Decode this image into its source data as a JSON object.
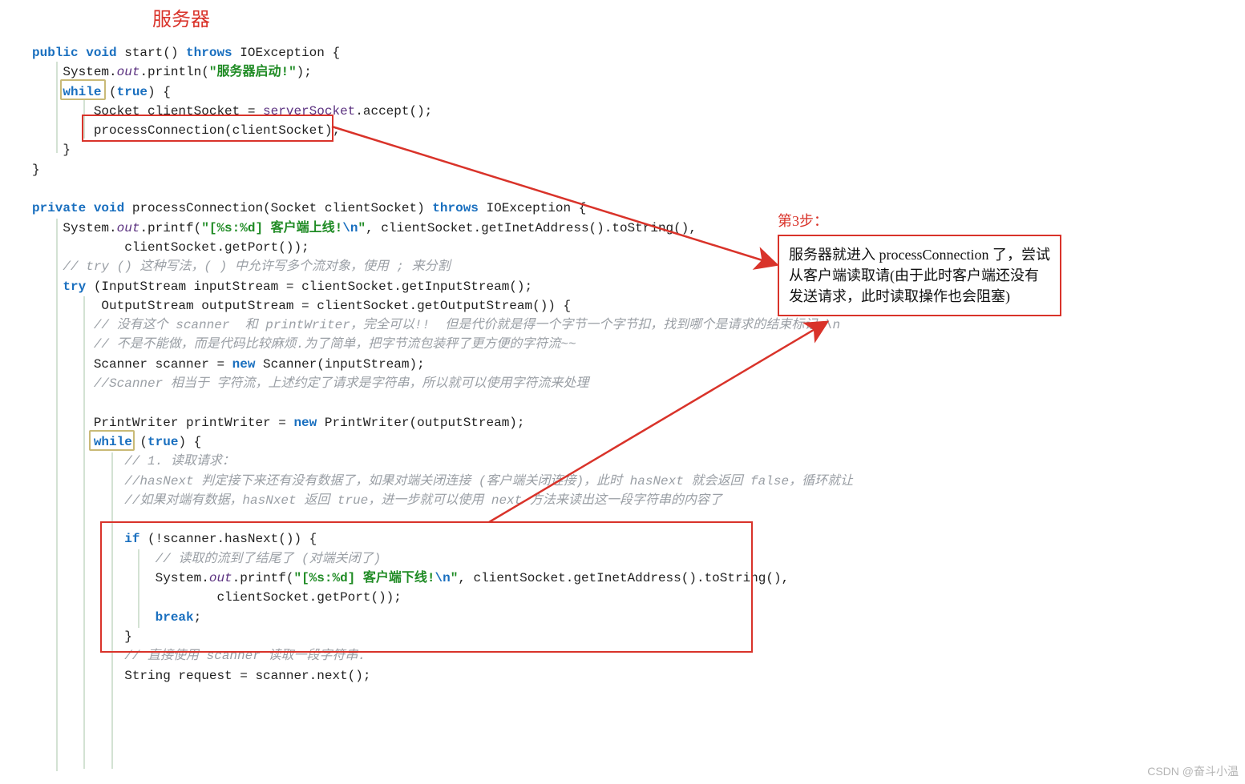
{
  "title": "服务器",
  "step_label": "第3步：",
  "callout": "服务器就进入 processConnection 了，尝试从客户端读取请(由于此时客户端还没有发送请求，此时读取操作也会阻塞)",
  "watermark": "CSDN @奋斗小温",
  "lines": [
    [
      [
        "kw",
        "public"
      ],
      [
        "p",
        " "
      ],
      [
        "kw",
        "void"
      ],
      [
        "p",
        " "
      ],
      [
        "p",
        "start() "
      ],
      [
        "kw",
        "throws"
      ],
      [
        "p",
        " IOException {"
      ]
    ],
    [
      [
        "p",
        "    System."
      ],
      [
        "id ital",
        "out"
      ],
      [
        "p",
        ".println("
      ],
      [
        "str",
        "\"服务器启动!\""
      ],
      [
        "p",
        ");"
      ]
    ],
    [
      [
        "p",
        "    "
      ],
      [
        "kw",
        "while"
      ],
      [
        "p",
        " ("
      ],
      [
        "kw",
        "true"
      ],
      [
        "p",
        ") {"
      ]
    ],
    [
      [
        "p",
        "        Socket clientSocket = "
      ],
      [
        "id",
        "serverSocket"
      ],
      [
        "p",
        ".accept();"
      ]
    ],
    [
      [
        "p",
        "        processConnection(clientSocket);"
      ]
    ],
    [
      [
        "p",
        "    }"
      ]
    ],
    [
      [
        "p",
        "}"
      ]
    ],
    [],
    [
      [
        "kw",
        "private"
      ],
      [
        "p",
        " "
      ],
      [
        "kw",
        "void"
      ],
      [
        "p",
        " processConnection(Socket clientSocket) "
      ],
      [
        "kw",
        "throws"
      ],
      [
        "p",
        " IOException {"
      ]
    ],
    [
      [
        "p",
        "    System."
      ],
      [
        "id ital",
        "out"
      ],
      [
        "p",
        ".printf("
      ],
      [
        "str",
        "\"[%s:%d] 客户端上线!"
      ],
      [
        "escape",
        "\\n"
      ],
      [
        "str",
        "\""
      ],
      [
        "p",
        ", clientSocket.getInetAddress().toString(),"
      ]
    ],
    [
      [
        "p",
        "            clientSocket.getPort());"
      ]
    ],
    [
      [
        "p",
        "    "
      ],
      [
        "cmt",
        "// try () 这种写法，( ) 中允许写多个流对象，使用 ; 来分割"
      ]
    ],
    [
      [
        "p",
        "    "
      ],
      [
        "kw",
        "try"
      ],
      [
        "p",
        " (InputStream inputStream = clientSocket.getInputStream();"
      ]
    ],
    [
      [
        "p",
        "         OutputStream outputStream = clientSocket.getOutputStream()) {"
      ]
    ],
    [
      [
        "p",
        "        "
      ],
      [
        "cmt",
        "// 没有这个 scanner  和 printWriter，完全可以!!  但是代价就是得一个字节一个字节扣，找到哪个是请求的结束标记 \\n"
      ]
    ],
    [
      [
        "p",
        "        "
      ],
      [
        "cmt",
        "// 不是不能做，而是代码比较麻烦.为了简单，把字节流包装秤了更方便的字符流~~"
      ]
    ],
    [
      [
        "p",
        "        Scanner scanner = "
      ],
      [
        "kw",
        "new"
      ],
      [
        "p",
        " Scanner(inputStream);"
      ]
    ],
    [
      [
        "p",
        "        "
      ],
      [
        "cmt",
        "//Scanner 相当于 字符流，上述约定了请求是字符串，所以就可以使用字符流来处理"
      ]
    ],
    [],
    [
      [
        "p",
        "        PrintWriter printWriter = "
      ],
      [
        "kw",
        "new"
      ],
      [
        "p",
        " PrintWriter(outputStream);"
      ]
    ],
    [
      [
        "p",
        "        "
      ],
      [
        "kw",
        "while"
      ],
      [
        "p",
        " ("
      ],
      [
        "kw",
        "true"
      ],
      [
        "p",
        ") {"
      ]
    ],
    [
      [
        "p",
        "            "
      ],
      [
        "cmt",
        "// 1. 读取请求："
      ]
    ],
    [
      [
        "p",
        "            "
      ],
      [
        "cmt",
        "//hasNext 判定接下来还有没有数据了，如果对端关闭连接 (客户端关闭连接)，此时 hasNext 就会返回 false，循环就让"
      ]
    ],
    [
      [
        "p",
        "            "
      ],
      [
        "cmt",
        "//如果对端有数据，hasNxet 返回 true，进一步就可以使用 next 方法来读出这一段字符串的内容了"
      ]
    ],
    [],
    [
      [
        "p",
        "            "
      ],
      [
        "kw",
        "if"
      ],
      [
        "p",
        " (!scanner.hasNext()) {"
      ]
    ],
    [
      [
        "p",
        "                "
      ],
      [
        "cmt",
        "// 读取的流到了结尾了 (对端关闭了)"
      ]
    ],
    [
      [
        "p",
        "                System."
      ],
      [
        "id ital",
        "out"
      ],
      [
        "p",
        ".printf("
      ],
      [
        "str",
        "\"[%s:%d] 客户端下线!"
      ],
      [
        "escape",
        "\\n"
      ],
      [
        "str",
        "\""
      ],
      [
        "p",
        ", clientSocket.getInetAddress().toString(),"
      ]
    ],
    [
      [
        "p",
        "                        clientSocket.getPort());"
      ]
    ],
    [
      [
        "p",
        "                "
      ],
      [
        "kw",
        "break"
      ],
      [
        "p",
        ";"
      ]
    ],
    [
      [
        "p",
        "            }"
      ]
    ],
    [
      [
        "p",
        "            "
      ],
      [
        "cmt",
        "// 直接使用 scanner 读取一段字符串."
      ]
    ],
    [
      [
        "p",
        "            String request = scanner.next();"
      ]
    ]
  ]
}
